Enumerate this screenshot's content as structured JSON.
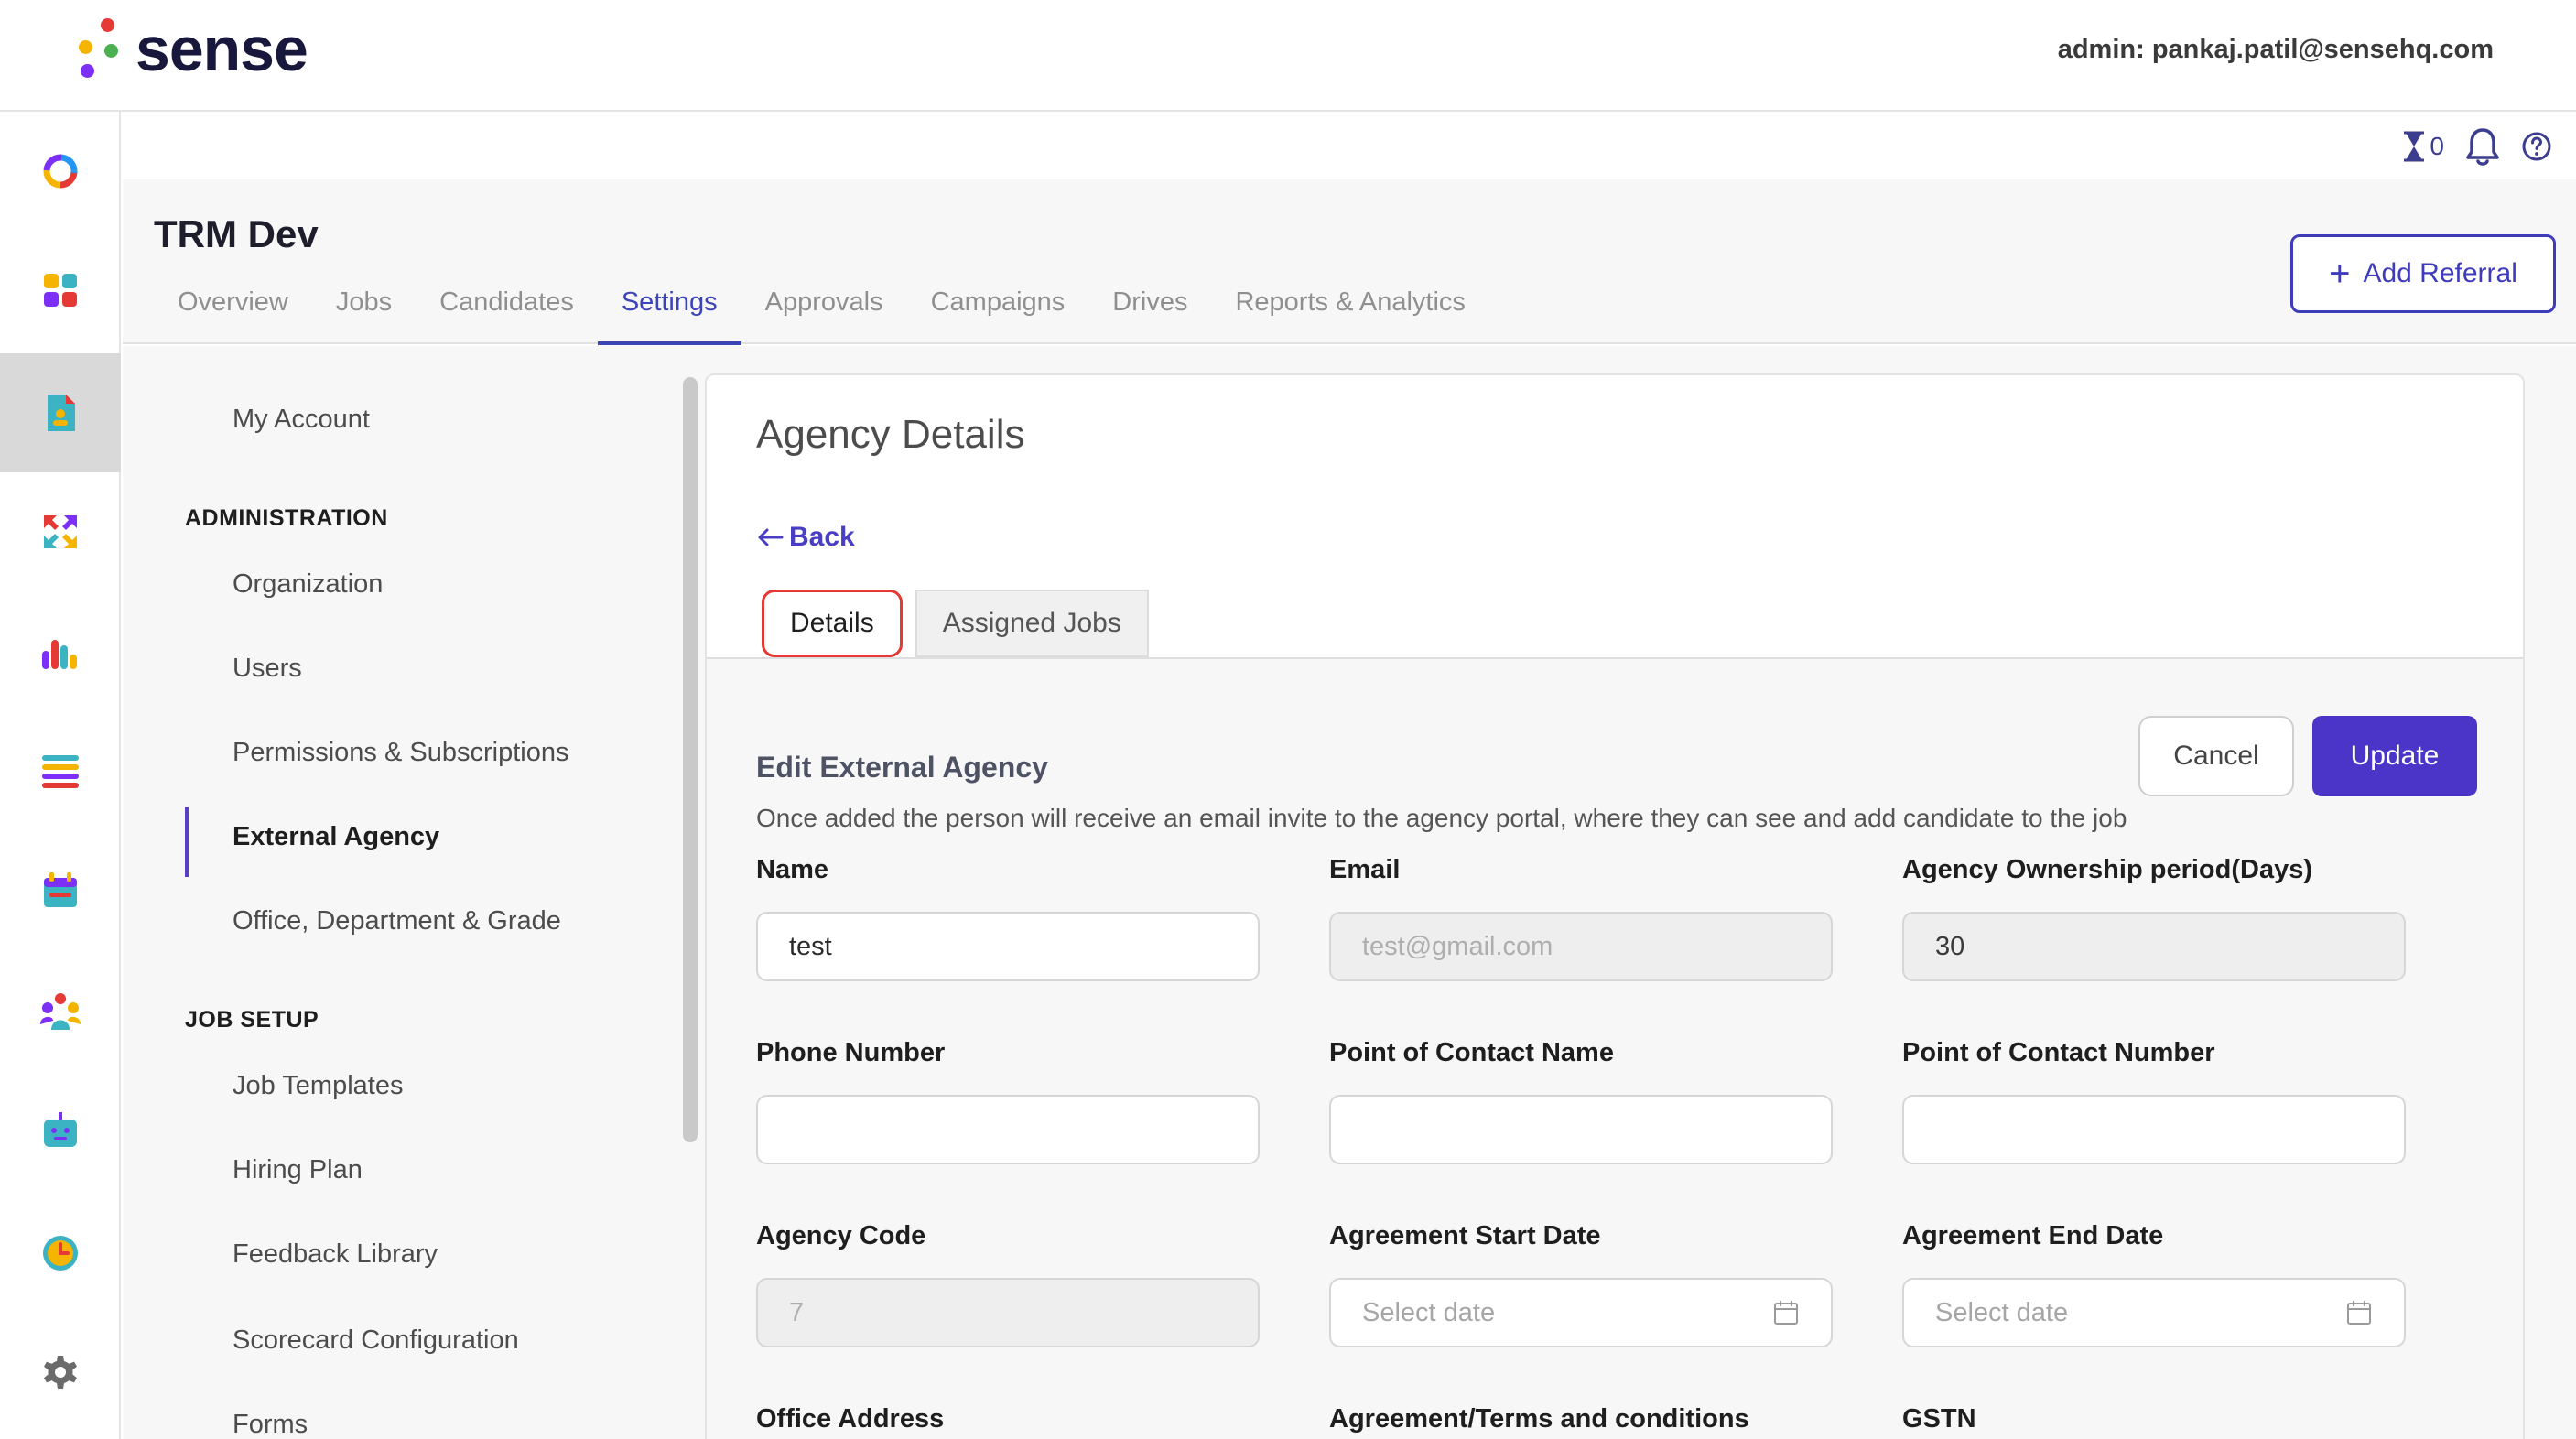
{
  "brand": {
    "logo_text": "sense",
    "dot_colors": [
      "#e53935",
      "#f5b400",
      "#4caf50",
      "#7b2ff7"
    ]
  },
  "header": {
    "admin_label": "admin: pankaj.patil@sensehq.com"
  },
  "toolbar": {
    "timer_count": "0",
    "icons": [
      "hourglass-icon",
      "bell-icon",
      "help-icon"
    ]
  },
  "rail": {
    "items": [
      "donut-icon",
      "apps-icon",
      "requisition-icon",
      "referral-arrows-icon",
      "analytics-icon",
      "list-icon",
      "calendar-icon",
      "team-icon",
      "bot-icon",
      "alarm-icon",
      "gear-icon"
    ],
    "active_index": 2
  },
  "project": {
    "title": "TRM Dev",
    "tabs": [
      {
        "label": "Overview"
      },
      {
        "label": "Jobs"
      },
      {
        "label": "Candidates"
      },
      {
        "label": "Settings"
      },
      {
        "label": "Approvals"
      },
      {
        "label": "Campaigns"
      },
      {
        "label": "Drives"
      },
      {
        "label": "Reports & Analytics"
      }
    ],
    "active_tab": "Settings",
    "add_referral_label": "Add Referral"
  },
  "settings_nav": {
    "my_account": "My Account",
    "administration_heading": "ADMINISTRATION",
    "administration_items": [
      "Organization",
      "Users",
      "Permissions & Subscriptions",
      "External Agency",
      "Office, Department & Grade"
    ],
    "active_item": "External Agency",
    "job_setup_heading": "JOB SETUP",
    "job_setup_items": [
      "Job Templates",
      "Hiring Plan",
      "Feedback Library",
      "Scorecard Configuration",
      "Forms"
    ]
  },
  "agency": {
    "title": "Agency Details",
    "back_label": "Back",
    "tabs": [
      "Details",
      "Assigned Jobs"
    ],
    "active_tab": "Details",
    "form_title": "Edit External Agency",
    "form_desc": "Once added the person will receive an email invite to the agency portal, where they can see and add candidate to the job",
    "cancel_label": "Cancel",
    "update_label": "Update",
    "fields": {
      "name": {
        "label": "Name",
        "value": "test"
      },
      "email": {
        "label": "Email",
        "value": "test@gmail.com"
      },
      "ownership": {
        "label": "Agency Ownership period(Days)",
        "value": "30"
      },
      "phone": {
        "label": "Phone Number",
        "value": ""
      },
      "poc_name": {
        "label": "Point of Contact Name",
        "value": ""
      },
      "poc_number": {
        "label": "Point of Contact Number",
        "value": ""
      },
      "code": {
        "label": "Agency Code",
        "value": "7"
      },
      "start_date": {
        "label": "Agreement Start Date",
        "placeholder": "Select date"
      },
      "end_date": {
        "label": "Agreement End Date",
        "placeholder": "Select date"
      },
      "office_address": {
        "label": "Office Address"
      },
      "terms": {
        "label": "Agreement/Terms and conditions"
      },
      "gstn": {
        "label": "GSTN"
      }
    }
  }
}
